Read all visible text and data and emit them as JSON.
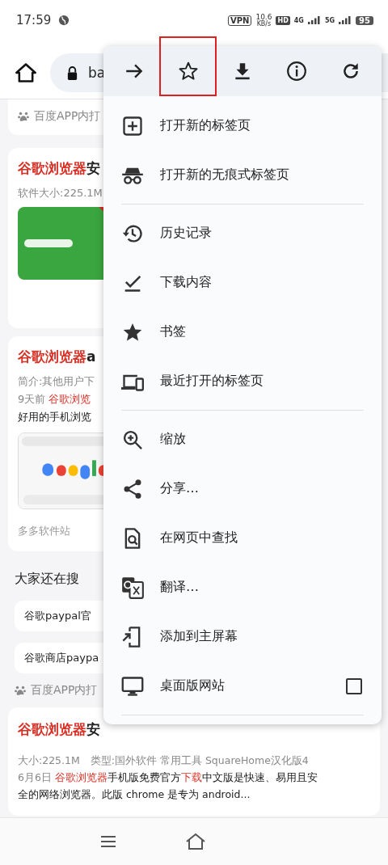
{
  "status_bar": {
    "time": "17:59",
    "vpn": "VPN",
    "speed": "10.6",
    "speed_unit": "KB/s",
    "hd": "HD",
    "network_4g": "4G",
    "network_5g": "5G",
    "battery": "95"
  },
  "toolbar": {
    "url": "ba"
  },
  "results": {
    "top_source": "百度APP内打",
    "cards": [
      {
        "title": [
          {
            "text": "谷歌浏览器",
            "highlight": true,
            "muted": false
          },
          {
            "text": "安",
            "highlight": false,
            "muted": false
          }
        ],
        "lines": [
          [
            {
              "text": "软件大小:225.1M",
              "highlight": false,
              "muted": true
            }
          ]
        ]
      },
      {
        "title": [
          {
            "text": "谷歌浏览器",
            "highlight": true,
            "muted": false
          },
          {
            "text": "a",
            "highlight": false,
            "muted": false
          }
        ],
        "lines": [
          [
            {
              "text": "简介:其他用户下",
              "highlight": false,
              "muted": true
            }
          ],
          [
            {
              "text": "9天前 ",
              "highlight": false,
              "muted": true
            },
            {
              "text": "谷歌浏览",
              "highlight": true,
              "muted": false
            }
          ],
          [
            {
              "text": "好用的手机浏览",
              "highlight": false,
              "muted": false
            }
          ]
        ],
        "footer": "多多软件站"
      }
    ],
    "related": {
      "title": "大家还在搜",
      "queries": [
        "谷歌paypal官",
        "谷歌商店paypa"
      ]
    },
    "source": "百度APP内打",
    "last_card": {
      "title": [
        {
          "text": "谷歌浏览器",
          "highlight": true,
          "muted": false
        },
        {
          "text": "安",
          "highlight": false,
          "muted": false
        }
      ],
      "lines": [
        [
          {
            "text": "大小:225.1M　类型:国外软件 常用工具 SquareHome汉化版4",
            "highlight": false,
            "muted": true
          }
        ],
        [
          {
            "text": "6月6日 ",
            "highlight": false,
            "muted": true
          },
          {
            "text": "谷歌浏览器",
            "highlight": true,
            "muted": false
          },
          {
            "text": "手机版免费官方",
            "highlight": false,
            "muted": false
          },
          {
            "text": "下载",
            "highlight": true,
            "muted": false
          },
          {
            "text": "中文版是快速、易用且安",
            "highlight": false,
            "muted": false
          }
        ],
        [
          {
            "text": "全的网络浏览器。此版 chrome 是专为 android...",
            "highlight": false,
            "muted": false
          }
        ]
      ]
    }
  },
  "menu": {
    "actions": [
      {
        "highlighted": false
      },
      {
        "highlighted": true
      },
      {
        "highlighted": false
      },
      {
        "highlighted": false
      },
      {
        "highlighted": false
      }
    ],
    "items": [
      {
        "kind": "item",
        "label": "打开新的标签页"
      },
      {
        "kind": "item",
        "label": "打开新的无痕式标签页"
      },
      {
        "kind": "divider"
      },
      {
        "kind": "item",
        "label": "历史记录"
      },
      {
        "kind": "item",
        "label": "下载内容"
      },
      {
        "kind": "item",
        "label": "书签"
      },
      {
        "kind": "item",
        "label": "最近打开的标签页"
      },
      {
        "kind": "divider"
      },
      {
        "kind": "item",
        "label": "缩放"
      },
      {
        "kind": "item",
        "label": "分享…"
      },
      {
        "kind": "item",
        "label": "在网页中查找"
      },
      {
        "kind": "item",
        "label": "翻译…"
      },
      {
        "kind": "item",
        "label": "添加到主屏幕"
      },
      {
        "kind": "checkbox",
        "label": "桌面版网站",
        "checked": false
      },
      {
        "kind": "divider"
      }
    ]
  }
}
